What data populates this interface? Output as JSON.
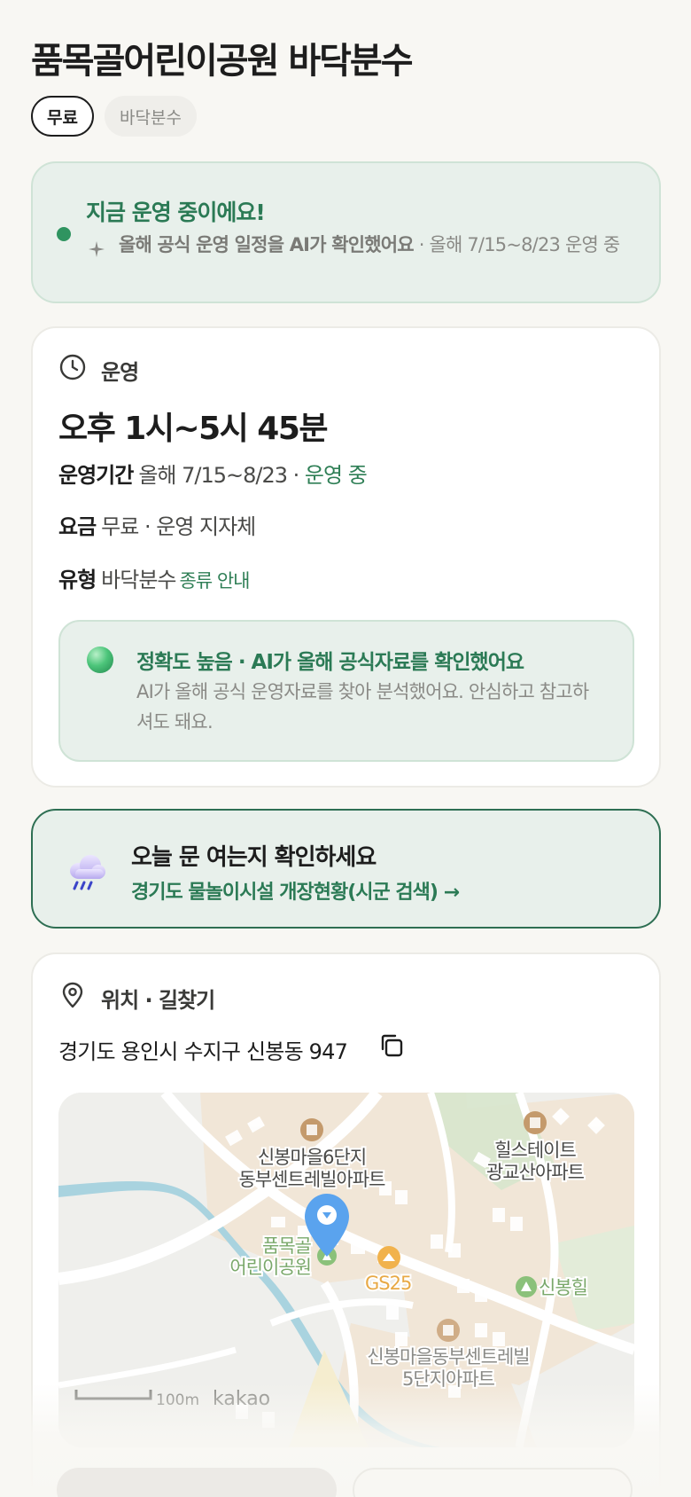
{
  "place": {
    "title": "품목골어린이공원 바닥분수",
    "chips": [
      "무료",
      "바닥분수"
    ]
  },
  "status": {
    "headline": "지금 운영 중이에요!",
    "note_strong": "올해 공식 운영 일정을 AI가 확인했어요",
    "note_rest": " · 올해 7/15~8/23 운영 중",
    "dot_color": "#2f9460"
  },
  "operation": {
    "section_label": "운영",
    "hours": "오후 1시~5시 45분",
    "period_key": "운영기간",
    "period_value": "올해 7/15~8/23 ·",
    "period_status": "운영 중",
    "fee_key": "요금",
    "fee_value": "무료 · 운영 지자체",
    "type_key": "유형",
    "type_value": "바닥분수",
    "type_link": "종류 안내",
    "accuracy": {
      "headline": "정확도 높음 · AI가 올해 공식자료를 확인했어요",
      "body": "AI가 올해 공식 운영자료를 찾아 분석했어요. 안심하고 참고하셔도 돼요."
    }
  },
  "check_today": {
    "headline": "오늘 문 여는지 확인하세요",
    "link": "경기도 물놀이시설 개장현황(시군 검색) →"
  },
  "location": {
    "section_label": "위치 · 길찾기",
    "address": "경기도 용인시 수지구 신봉동 947",
    "map": {
      "labels": {
        "apt1_line1": "신봉마을6단지",
        "apt1_line2": "동부센트레빌아파트",
        "apt2_line1": "힐스테이트",
        "apt2_line2": "광교산아파트",
        "park_line1": "품목골",
        "park_line2": "어린이공원",
        "store": "GS25",
        "hill": "신봉힐",
        "apt3_line1": "신봉마을동부센트레빌",
        "apt3_line2": "5단지아파트",
        "scale": "100m",
        "brand": "kakao"
      }
    }
  },
  "colors": {
    "accent_green": "#2b7a55",
    "background": "#f8f7f3",
    "pin_blue": "#5aa3ee"
  }
}
